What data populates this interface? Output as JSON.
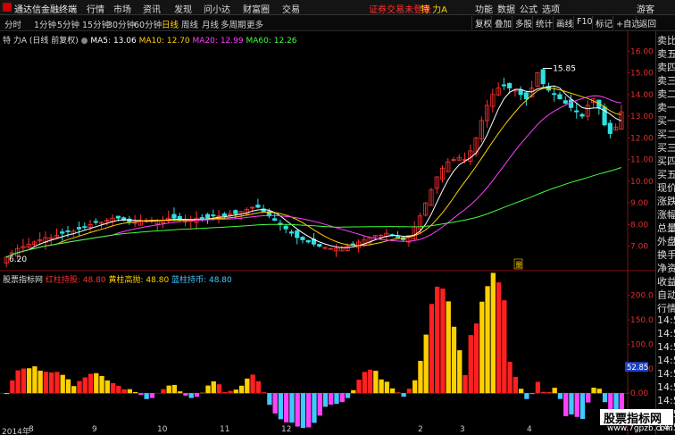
{
  "app": {
    "title": "通达信金融终端",
    "menu": [
      "行情",
      "市场",
      "资讯",
      "发现",
      "问小达",
      "财富圈",
      "交易"
    ],
    "trade_warning": "证券交易未登录",
    "stock_name": "特 力A",
    "right_menu": [
      "功能",
      "数据",
      "公式",
      "选项"
    ],
    "guest": "游客"
  },
  "toolbar": {
    "periods": [
      "分时",
      "1分钟",
      "5分钟",
      "15分钟",
      "30分钟",
      "60分钟",
      "日线",
      "周线",
      "月线",
      "多周期",
      "更多"
    ],
    "active_period": "日线",
    "right_buttons": [
      "复权",
      "叠加",
      "多股",
      "统计",
      "画线",
      "F10",
      "标记",
      "+自选",
      "返回"
    ]
  },
  "main_chart": {
    "label": "特 力A (日线 前复权)",
    "ma": [
      {
        "name": "MA5",
        "value": "13.06",
        "color": "#ffffff"
      },
      {
        "name": "MA10",
        "value": "12.70",
        "color": "#ffd000"
      },
      {
        "name": "MA20",
        "value": "12.99",
        "color": "#ff40ff"
      },
      {
        "name": "MA60",
        "value": "12.26",
        "color": "#40ff40"
      }
    ],
    "high_label": "15.85",
    "low_label": "6.20",
    "y_ticks": [
      "16.00",
      "15.00",
      "14.00",
      "13.00",
      "12.00",
      "11.00",
      "10.00",
      "9.00",
      "8.00",
      "7.00"
    ],
    "marker": "量"
  },
  "indicator": {
    "name": "股票指标网",
    "items": [
      {
        "name": "红柱持股",
        "value": "48.80",
        "color": "#ff3030"
      },
      {
        "name": "黄柱高抛",
        "value": "48.80",
        "color": "#ffd000"
      },
      {
        "name": "蓝柱持币",
        "value": "48.80",
        "color": "#40c8ff"
      }
    ],
    "y_ticks": [
      "200.0",
      "150.0",
      "100.0",
      "50.00",
      "0.00",
      "-50.00"
    ],
    "current_value": "52.85"
  },
  "x_axis": [
    "2014年",
    "8",
    "9",
    "10",
    "11",
    "12",
    "2",
    "3",
    "4"
  ],
  "side_panel": [
    "卖比",
    "卖五",
    "卖四",
    "卖三",
    "卖二",
    "卖一",
    "买一",
    "买二",
    "买三",
    "买四",
    "买五",
    "现价",
    "涨跌",
    "涨幅",
    "总量",
    "外盘",
    "换手",
    "净资",
    "收益",
    "自动",
    "行情",
    "14:55",
    "14:55",
    "14:55",
    "14:55",
    "14:55",
    "14:55",
    "14:55",
    "14:55",
    "14:55"
  ],
  "watermark": {
    "text": "股票指标网",
    "url": "www.7gpzb.com"
  },
  "chart_data": {
    "type": "candlestick",
    "title": "特 力A (日线 前复权)",
    "ylim": [
      6.0,
      16.3
    ],
    "closes": [
      6.5,
      6.7,
      6.9,
      7.0,
      7.1,
      7.2,
      7.3,
      7.4,
      7.4,
      7.5,
      7.6,
      7.7,
      7.7,
      7.8,
      7.9,
      8.0,
      8.1,
      8.1,
      8.2,
      8.3,
      8.3,
      8.2,
      8.1,
      8.1,
      8.2,
      8.2,
      8.2,
      8.2,
      8.2,
      8.3,
      8.3,
      8.2,
      8.2,
      8.2,
      8.3,
      8.3,
      8.3,
      8.4,
      8.4,
      8.4,
      8.5,
      8.5,
      8.6,
      8.7,
      8.8,
      8.8,
      8.6,
      8.4,
      8.2,
      8.0,
      7.8,
      7.6,
      7.4,
      7.3,
      7.2,
      7.1,
      7.0,
      6.95,
      6.9,
      6.9,
      6.95,
      7.0,
      7.1,
      7.2,
      7.3,
      7.4,
      7.5,
      7.5,
      7.6,
      7.5,
      7.4,
      7.3,
      7.5,
      7.9,
      8.4,
      9.0,
      9.6,
      10.2,
      10.6,
      10.9,
      11.0,
      11.1,
      11.0,
      11.4,
      12.0,
      12.8,
      13.5,
      14.0,
      14.3,
      14.4,
      14.3,
      14.2,
      14.0,
      13.8,
      14.3,
      15.0,
      14.5,
      14.2,
      14.0,
      13.8,
      13.6,
      13.4,
      13.2,
      13.0,
      13.5,
      13.8,
      13.4,
      12.6,
      12.2,
      12.5,
      13.2
    ]
  }
}
